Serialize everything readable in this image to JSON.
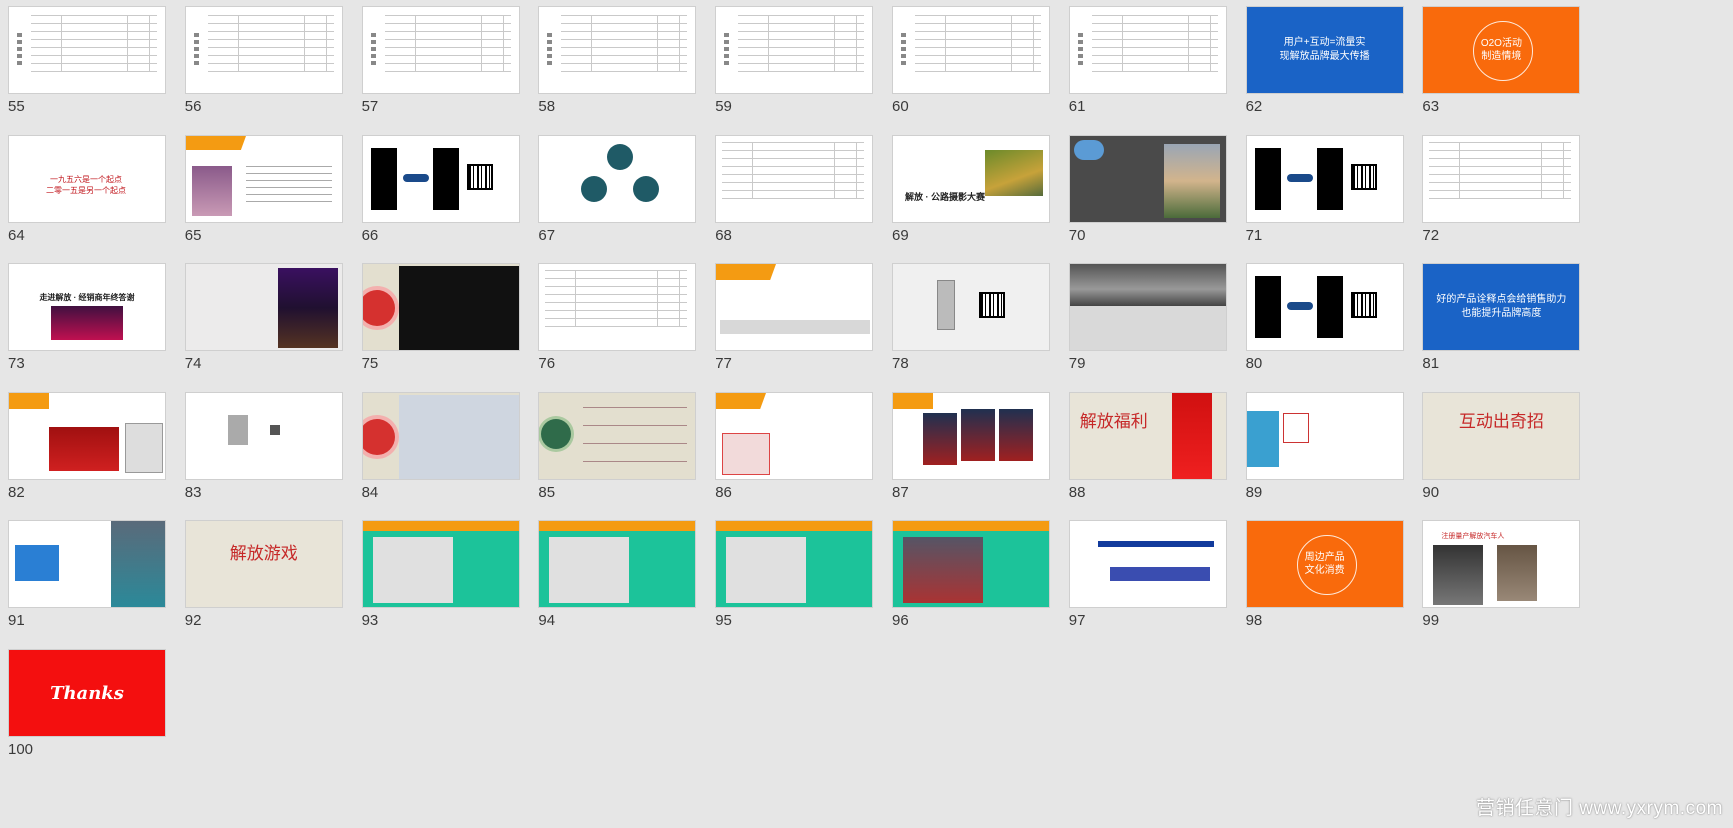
{
  "slides": [
    {
      "n": "55",
      "kind": "table-v"
    },
    {
      "n": "56",
      "kind": "table-v"
    },
    {
      "n": "57",
      "kind": "table-v"
    },
    {
      "n": "58",
      "kind": "table-v"
    },
    {
      "n": "59",
      "kind": "table-v"
    },
    {
      "n": "60",
      "kind": "table-v"
    },
    {
      "n": "61",
      "kind": "table-v"
    },
    {
      "n": "62",
      "kind": "solid",
      "bg": "#1a63c6",
      "color": "#ffffff",
      "text": "用户+互动=流量实\n现解放品牌最大传播"
    },
    {
      "n": "63",
      "kind": "circle",
      "bg": "#f96a0c",
      "color": "#ffffff",
      "text": "O2O活动\n制造情境"
    },
    {
      "n": "64",
      "kind": "calli",
      "text": "一九五六是一个起点\n二零一五是另一个起点"
    },
    {
      "n": "65",
      "kind": "photo-mix"
    },
    {
      "n": "66",
      "kind": "video-qr"
    },
    {
      "n": "67",
      "kind": "cycle"
    },
    {
      "n": "68",
      "kind": "table"
    },
    {
      "n": "69",
      "kind": "road",
      "text": "解放 · 公路摄影大赛"
    },
    {
      "n": "70",
      "kind": "dark-photos"
    },
    {
      "n": "71",
      "kind": "video-qr"
    },
    {
      "n": "72",
      "kind": "table"
    },
    {
      "n": "73",
      "kind": "concert",
      "text": "走进解放 · 经销商年终答谢"
    },
    {
      "n": "74",
      "kind": "stage"
    },
    {
      "n": "75",
      "kind": "phone-circle"
    },
    {
      "n": "76",
      "kind": "table"
    },
    {
      "n": "77",
      "kind": "text-slide"
    },
    {
      "n": "78",
      "kind": "phone-qr"
    },
    {
      "n": "79",
      "kind": "bw-photo"
    },
    {
      "n": "80",
      "kind": "video-qr"
    },
    {
      "n": "81",
      "kind": "solid",
      "bg": "#1a63c6",
      "color": "#ffffff",
      "text": "好的产品诠释点会给销售助力\n也能提升品牌高度"
    },
    {
      "n": "82",
      "kind": "posters"
    },
    {
      "n": "83",
      "kind": "sparse"
    },
    {
      "n": "84",
      "kind": "phone-circle2"
    },
    {
      "n": "85",
      "kind": "beige-list"
    },
    {
      "n": "86",
      "kind": "game-ui"
    },
    {
      "n": "87",
      "kind": "trucks-pk"
    },
    {
      "n": "88",
      "kind": "beige-title",
      "text": "解放福利"
    },
    {
      "n": "89",
      "kind": "shirt"
    },
    {
      "n": "90",
      "kind": "beige-title2",
      "text": "互动出奇招"
    },
    {
      "n": "91",
      "kind": "flow-photo"
    },
    {
      "n": "92",
      "kind": "beige-title3",
      "text": "解放游戏"
    },
    {
      "n": "93",
      "kind": "green-a"
    },
    {
      "n": "94",
      "kind": "green-b"
    },
    {
      "n": "95",
      "kind": "green-c"
    },
    {
      "n": "96",
      "kind": "green-d"
    },
    {
      "n": "97",
      "kind": "timeline"
    },
    {
      "n": "98",
      "kind": "circle",
      "bg": "#f96a0c",
      "color": "#ffffff",
      "text": "周边产品\n文化消费"
    },
    {
      "n": "99",
      "kind": "robot",
      "text": "注册量产解放汽车人"
    },
    {
      "n": "100",
      "kind": "thanks",
      "bg": "#f40f0f",
      "text": "Thanks"
    }
  ],
  "watermark": "营销任意门 www.yxrym.com"
}
